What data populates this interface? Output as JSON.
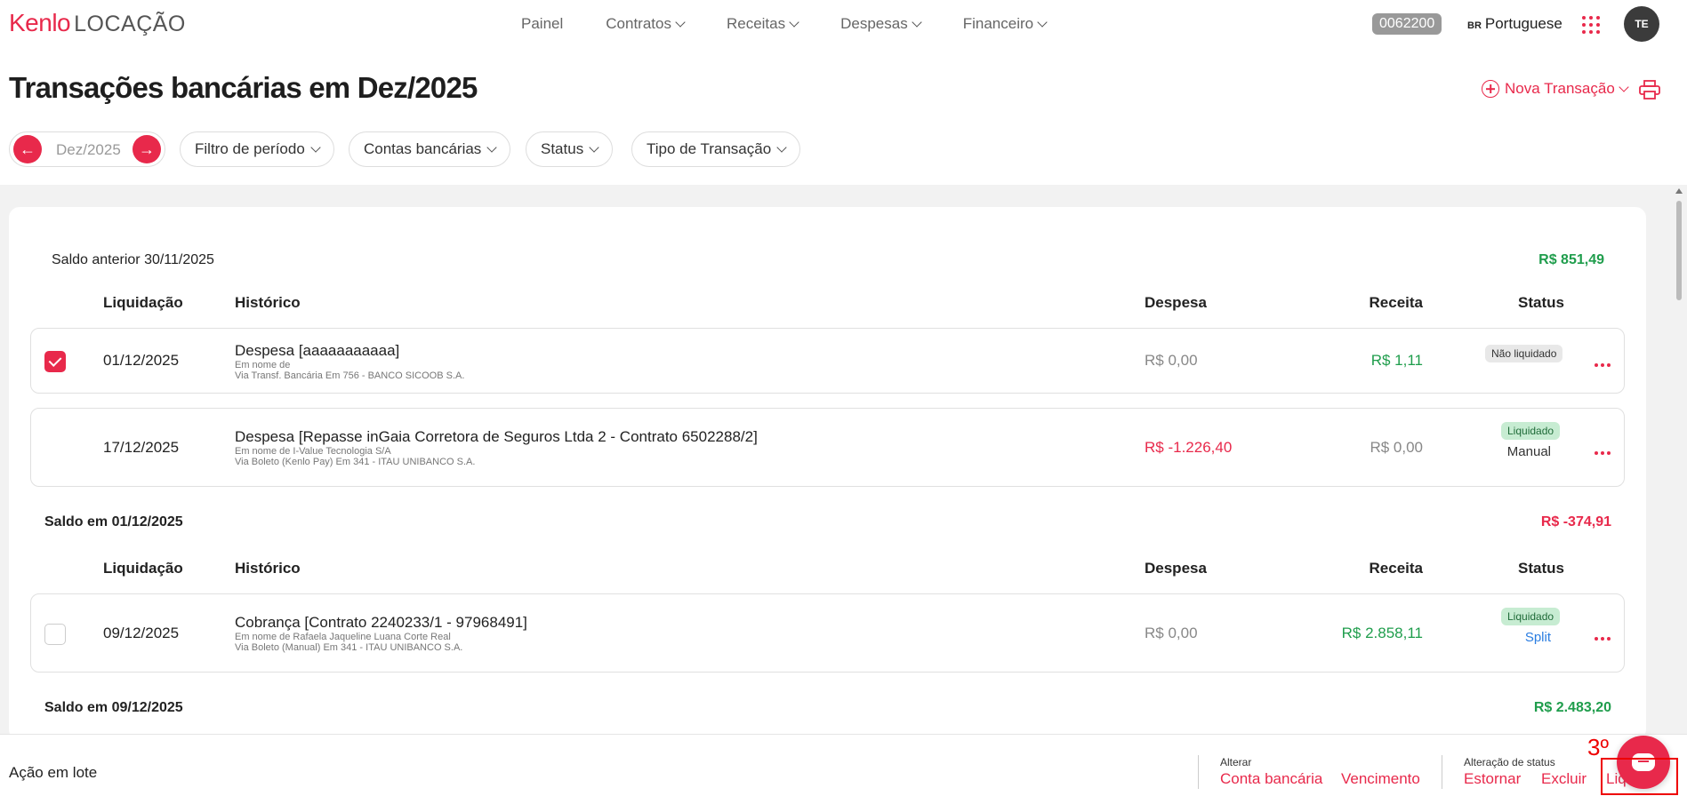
{
  "header": {
    "logo_brand": "Kenlo",
    "logo_product": "LOCAÇÃO",
    "nav": [
      {
        "label": "Painel"
      },
      {
        "label": "Contratos"
      },
      {
        "label": "Receitas"
      },
      {
        "label": "Despesas"
      },
      {
        "label": "Financeiro"
      }
    ],
    "account_code": "0062200",
    "language_flag": "BR",
    "language": "Portuguese",
    "avatar_initials": "TE"
  },
  "page": {
    "title": "Transações bancárias em Dez/2025",
    "new_transaction_label": "Nova Transação"
  },
  "filters": {
    "period_value": "Dez/2025",
    "period_filter": "Filtro de período",
    "bank_accounts": "Contas bancárias",
    "status": "Status",
    "transaction_type": "Tipo de Transação"
  },
  "columns": {
    "liquidacao": "Liquidação",
    "historico": "Histórico",
    "despesa": "Despesa",
    "receita": "Receita",
    "status": "Status"
  },
  "groups": [
    {
      "saldo_label": "Saldo anterior 30/11/2025",
      "saldo_value": "R$ 851,49",
      "rows": [
        {
          "checked": true,
          "date": "01/12/2025",
          "title": "Despesa [aaaaaaaaaaa]",
          "line1": "Em nome de",
          "line2": "Via Transf. Bancária Em 756 - BANCO SICOOB S.A.",
          "despesa": "R$ 0,00",
          "receita": "R$ 1,11",
          "status": "Não liquidado",
          "status_sub": ""
        },
        {
          "checked": false,
          "date": "17/12/2025",
          "title": "Despesa [Repasse inGaia Corretora de Seguros Ltda 2 - Contrato 6502288/2]",
          "line1": "Em nome de I-Value Tecnologia S/A",
          "line2": "Via Boleto (Kenlo Pay) Em 341 - ITAU UNIBANCO S.A.",
          "despesa": "R$ -1.226,40",
          "receita": "R$ 0,00",
          "status": "Liquidado",
          "status_sub": "Manual"
        }
      ]
    },
    {
      "saldo_label": "Saldo em 01/12/2025",
      "saldo_value": "R$ -374,91",
      "rows": [
        {
          "checked": false,
          "date": "09/12/2025",
          "title": "Cobrança [Contrato 2240233/1 - 97968491]",
          "line1": "Em nome de Rafaela Jaqueline Luana Corte Real",
          "line2": "Via Boleto (Manual) Em 341 - ITAU UNIBANCO S.A.",
          "despesa": "R$ 0,00",
          "receita": "R$ 2.858,11",
          "status": "Liquidado",
          "status_sub": "Split"
        }
      ]
    },
    {
      "saldo_label": "Saldo em 09/12/2025",
      "saldo_value": "R$ 2.483,20",
      "rows": []
    }
  ],
  "bottom_bar": {
    "batch_label": "Ação em lote",
    "alterar_label": "Alterar",
    "alterar_actions": [
      "Conta bancária",
      "Vencimento"
    ],
    "status_label": "Alteração de status",
    "status_actions": [
      "Estornar",
      "Excluir",
      "Liq"
    ],
    "annotation_number": "3º"
  },
  "colors": {
    "accent": "#e8294b",
    "positive": "#1f9d4c",
    "negative": "#e8294b"
  }
}
